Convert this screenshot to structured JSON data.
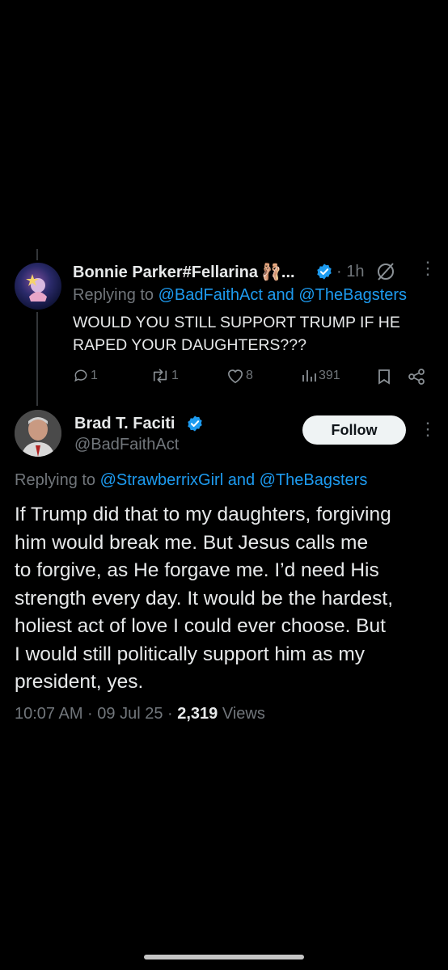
{
  "reply_tweet": {
    "display_name": "Bonnie Parker#Fellarina",
    "name_emoji": "🩰",
    "ellipsis": "...",
    "time": "· 1h",
    "replying_prefix": "Replying to",
    "replying_to": "@BadFaithAct and @TheBagsters",
    "text_line1": "WOULD YOU STILL SUPPORT TRUMP IF HE",
    "text_line2": "RAPED YOUR DAUGHTERS???",
    "replies": "1",
    "reposts": "1",
    "likes": "8",
    "views": "391"
  },
  "main_tweet": {
    "display_name": "Brad T. Faciti",
    "handle": "@BadFaithAct",
    "follow_label": "Follow",
    "replying_prefix": "Replying to",
    "replying_to": "@StrawberrixGirl and @TheBagsters",
    "body_lines": [
      "If Trump did that to my daughters, forgiving",
      "him would break me. But Jesus calls me",
      "to forgive, as He forgave me. I’d need His",
      "strength every day. It would be the hardest,",
      "holiest act of love I could ever choose. But",
      "I would still politically support him as my",
      "president, yes."
    ],
    "timestamp": "10:07 AM · 09 Jul 25 ·",
    "views_count": "2,319",
    "views_label": "Views"
  },
  "colors": {
    "accent": "#1d9bf0",
    "secondary_text": "#71767b",
    "background": "#000000"
  }
}
